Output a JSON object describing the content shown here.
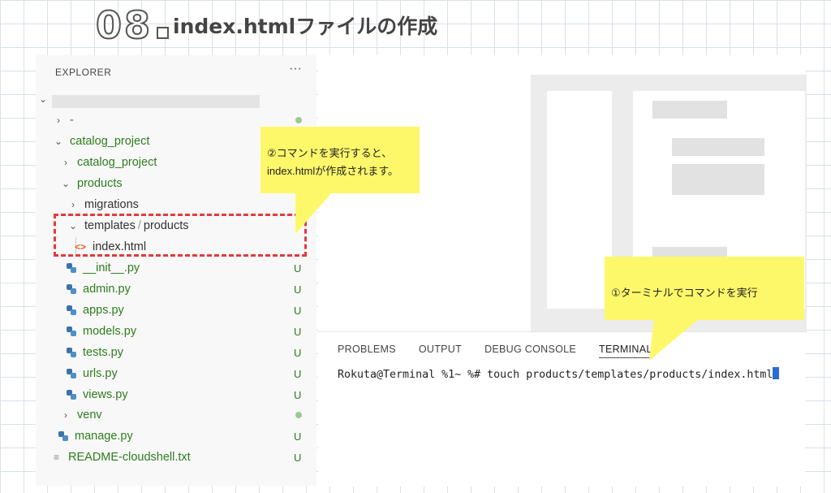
{
  "heading": {
    "number": "08",
    "title": "index.htmlファイルの作成"
  },
  "explorer": {
    "header": "EXPLORER",
    "menu_glyph": "···",
    "items": [
      {
        "label": "-",
        "chevron": "›",
        "status": "dot"
      },
      {
        "label": "catalog_project",
        "chevron": "⌄"
      },
      {
        "label": "catalog_project",
        "chevron": "›"
      },
      {
        "label": "products",
        "chevron": "⌄"
      },
      {
        "label": "migrations",
        "chevron": "›"
      },
      {
        "label": "templates",
        "separator": "/",
        "label2": "products",
        "chevron": "⌄"
      },
      {
        "label": "index.html",
        "icon": "<>"
      },
      {
        "label": "__init__.py",
        "status": "U"
      },
      {
        "label": "admin.py",
        "status": "U"
      },
      {
        "label": "apps.py",
        "status": "U"
      },
      {
        "label": "models.py",
        "status": "U"
      },
      {
        "label": "tests.py",
        "status": "U"
      },
      {
        "label": "urls.py",
        "status": "U"
      },
      {
        "label": "views.py",
        "status": "U"
      },
      {
        "label": "venv",
        "chevron": "›",
        "status": "dot"
      },
      {
        "label": "manage.py",
        "status": "U"
      },
      {
        "label": "README-cloudshell.txt",
        "status": "U"
      }
    ]
  },
  "terminal": {
    "tabs": [
      "PROBLEMS",
      "OUTPUT",
      "DEBUG CONSOLE",
      "TERMINAL"
    ],
    "command_line": "Rokuta@Terminal %1~ %# touch products/templates/products/index.html"
  },
  "callouts": {
    "first_line1": "②コマンドを実行すると、",
    "first_line2": "index.htmlが作成されます。",
    "second": "①ターミナルでコマンドを実行"
  },
  "colors": {
    "accent_red": "#e23b3b",
    "callout_yellow": "#fdf86a",
    "tree_green": "#2d7d1d",
    "cursor_blue": "#2a6bd8"
  }
}
